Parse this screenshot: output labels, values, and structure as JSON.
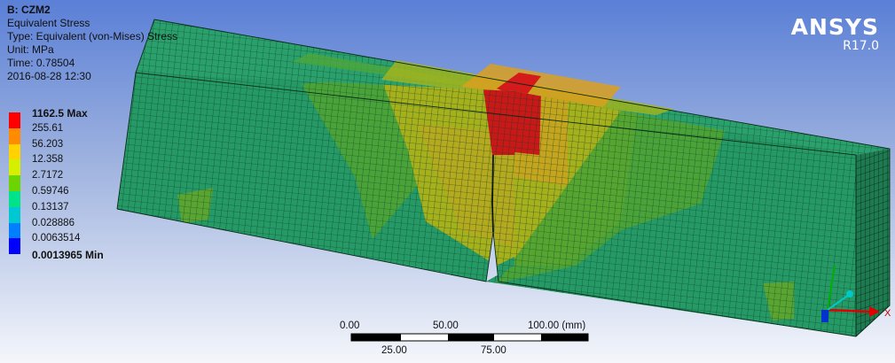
{
  "info": {
    "title": "B: CZM2",
    "result": "Equivalent Stress",
    "type": "Type: Equivalent (von-Mises) Stress",
    "unit": "Unit: MPa",
    "time": "Time: 0.78504",
    "date": "2016-08-28 12:30"
  },
  "legend": {
    "max_label": "1162.5 Max",
    "min_label": "0.0013965 Min",
    "levels": [
      "255.61",
      "56.203",
      "12.358",
      "2.7172",
      "0.59746",
      "0.13137",
      "0.028886",
      "0.0063514"
    ],
    "colors": [
      "#ff0000",
      "#ff8c00",
      "#ffd200",
      "#d6ee00",
      "#6cd400",
      "#00e38a",
      "#00c8d2",
      "#0080ff",
      "#0000ff"
    ]
  },
  "brand": {
    "name": "ANSYS",
    "version": "R17.0"
  },
  "scale_bar": {
    "top_labels": [
      "0.00",
      "50.00",
      "100.00 (mm)"
    ],
    "bottom_labels": [
      "25.00",
      "75.00"
    ]
  },
  "axes": {
    "x_label": "X"
  },
  "colors": {
    "mesh_base": "#259966",
    "mesh_line": "#0d3d24",
    "hot": "#d01818",
    "orange": "#d89a1c",
    "yellow_green": "#a6b319",
    "green": "#5aa531"
  }
}
